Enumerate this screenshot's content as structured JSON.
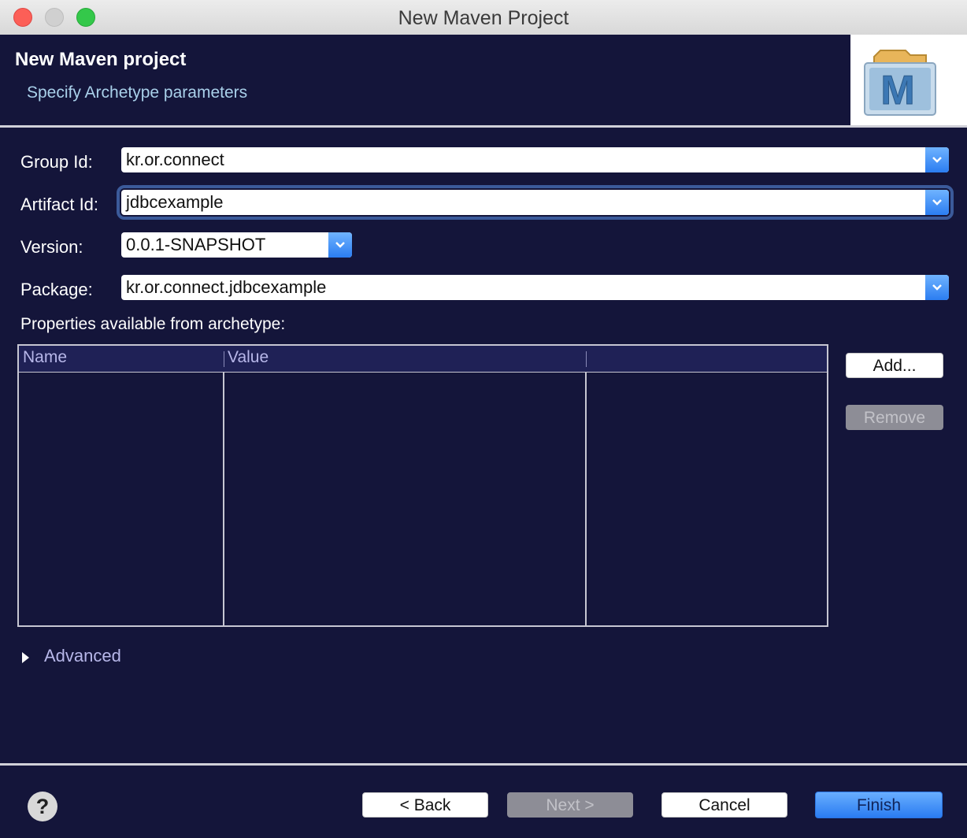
{
  "window": {
    "title": "New Maven Project"
  },
  "banner": {
    "title": "New Maven project",
    "subtitle": "Specify Archetype parameters",
    "logo_letter": "M"
  },
  "form": {
    "group_id": {
      "label": "Group Id:",
      "value": "kr.or.connect"
    },
    "artifact_id": {
      "label": "Artifact Id:",
      "value": "jdbcexample"
    },
    "version": {
      "label": "Version:",
      "value": "0.0.1-SNAPSHOT"
    },
    "package": {
      "label": "Package:",
      "value": "kr.or.connect.jdbcexample"
    }
  },
  "properties": {
    "label": "Properties available from archetype:",
    "columns": [
      "Name",
      "Value",
      ""
    ],
    "rows": [],
    "add_label": "Add...",
    "remove_label": "Remove"
  },
  "advanced": {
    "label": "Advanced"
  },
  "footer": {
    "help_glyph": "?",
    "back_label": "< Back",
    "next_label": "Next >",
    "cancel_label": "Cancel",
    "finish_label": "Finish"
  },
  "colors": {
    "background": "#14153a",
    "accent": "#2a7cf2",
    "header_text": "#b7b7e9"
  }
}
